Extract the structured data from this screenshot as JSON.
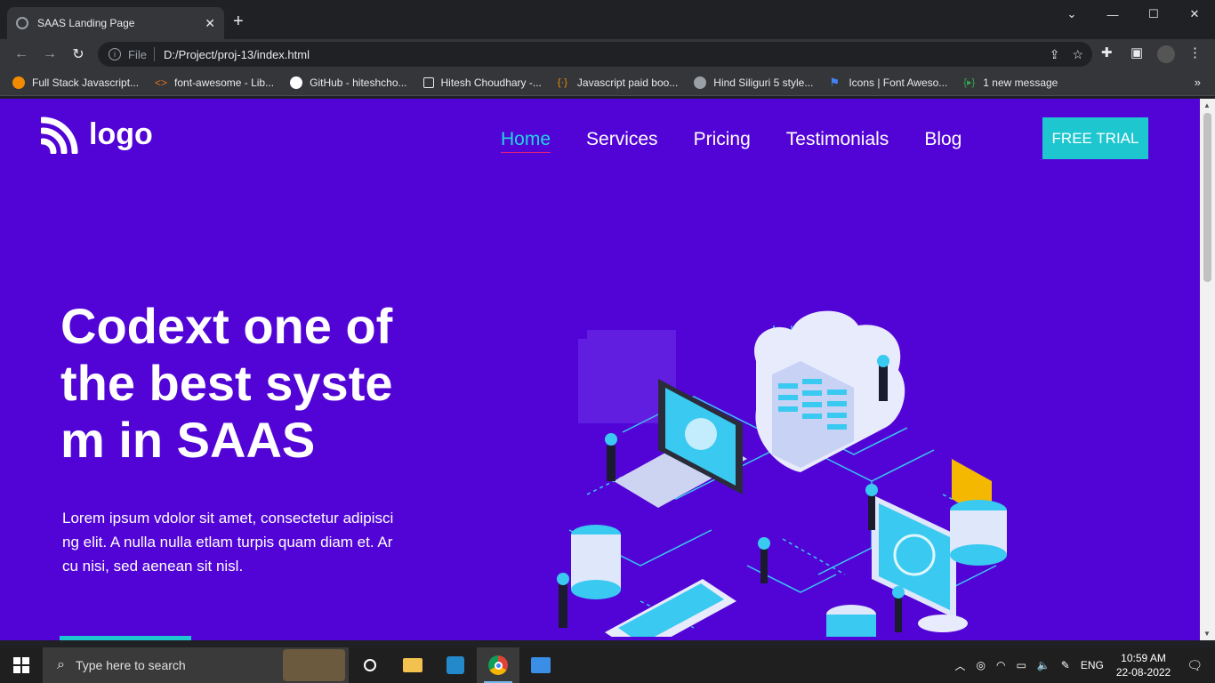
{
  "browser": {
    "tab_title": "SAAS Landing Page",
    "new_tab": "+",
    "address_scheme": "File",
    "address_url": "D:/Project/proj-13/index.html",
    "bookmarks": [
      {
        "label": "Full Stack Javascript..."
      },
      {
        "label": "font-awesome - Lib..."
      },
      {
        "label": "GitHub - hiteshcho..."
      },
      {
        "label": "Hitesh Choudhary -..."
      },
      {
        "label": "Javascript paid boo..."
      },
      {
        "label": "Hind Siliguri 5 style..."
      },
      {
        "label": "Icons | Font Aweso..."
      },
      {
        "label": "1 new message"
      }
    ],
    "bookmarks_more": "»"
  },
  "site": {
    "logo_text": "logo",
    "nav": [
      {
        "label": "Home",
        "active": true
      },
      {
        "label": "Services"
      },
      {
        "label": "Pricing"
      },
      {
        "label": "Testimonials"
      },
      {
        "label": "Blog"
      }
    ],
    "cta_label": "FREE TRIAL",
    "hero_title": "Codext one of the best system in SAAS",
    "hero_text": "Lorem ipsum vdolor sit amet, consectetur adipiscing elit. A nulla nulla etlam turpis quam diam et. Arcu nisi, sed aenean sit nisl.",
    "colors": {
      "background": "#5204d6",
      "accent": "#1ec6cf",
      "active_nav": "#20d6e0"
    }
  },
  "taskbar": {
    "search_placeholder": "Type here to search",
    "language": "ENG",
    "time": "10:59 AM",
    "date": "22-08-2022"
  }
}
